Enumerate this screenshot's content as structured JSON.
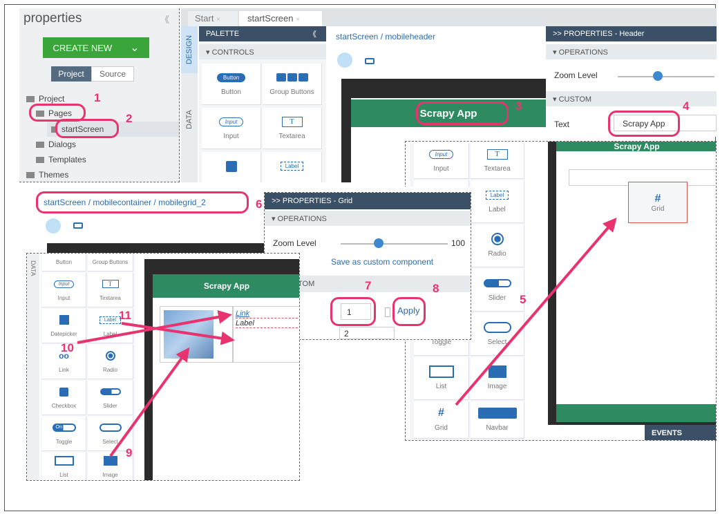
{
  "left_panel": {
    "title": "properties",
    "collapse": "《",
    "create_new": "CREATE NEW",
    "create_chevron": "⌄",
    "tab_project": "Project",
    "tab_source": "Source",
    "tree": [
      "Project",
      "Pages",
      "startScreen",
      "Dialogs",
      "Templates",
      "Themes"
    ]
  },
  "tabs": {
    "start": "Start",
    "start_close": "×",
    "startscreen": "startScreen",
    "startscreen_close": "×"
  },
  "side_tabs": {
    "design": "DESIGN",
    "data": "DATA"
  },
  "palette": {
    "title": "PALETTE",
    "collapse": "《",
    "section": "▾ CONTROLS",
    "items": [
      {
        "label": "Button",
        "icon_text": "Button"
      },
      {
        "label": "Group Buttons"
      },
      {
        "label": "Input",
        "icon_text": "Input"
      },
      {
        "label": "Textarea",
        "icon_text": "T"
      },
      {
        "label": ""
      },
      {
        "label": "",
        "icon_text": "Label"
      }
    ]
  },
  "screen1": {
    "breadcrumb": "startScreen / mobileheader",
    "header": "Scrapy App"
  },
  "props_header": {
    "title": ">> PROPERTIES - Header",
    "operations": "▾ OPERATIONS",
    "zoom": "Zoom Level",
    "custom": "▾ CUSTOM",
    "text_label": "Text",
    "text_value": "Scrapy App"
  },
  "palette_right": {
    "items": [
      {
        "label": "Input",
        "icon_text": "Input"
      },
      {
        "label": "Textarea",
        "icon_text": "T"
      },
      {
        "label": "",
        "icon_text": ""
      },
      {
        "label": "Label",
        "icon_text": "Label"
      },
      {
        "label": "Radio"
      },
      {
        "label": "Slider"
      },
      {
        "label": "Toggle"
      },
      {
        "label": "Select"
      },
      {
        "label": "List"
      },
      {
        "label": "Image"
      },
      {
        "label": "Grid"
      },
      {
        "label": "Navbar"
      }
    ]
  },
  "screen_right": {
    "header": "Scrapy App",
    "grid_label": "Grid",
    "events": "EVENTS"
  },
  "second": {
    "breadcrumb": "startScreen / mobilecontainer / mobilegrid_2",
    "props_title": ">> PROPERTIES - Grid",
    "operations": "▾ OPERATIONS",
    "zoom": "Zoom Level",
    "zoom_value": "100",
    "save_custom": "Save as custom component",
    "custom": "TOM",
    "rows_value": "1",
    "cols_value": "2",
    "apply": "Apply"
  },
  "palette_left": {
    "data_tab": "DATA",
    "items": [
      {
        "label": "Button"
      },
      {
        "label": "Group Buttons"
      },
      {
        "label": "Input",
        "icon_text": "Input"
      },
      {
        "label": "Textarea",
        "icon_text": "T"
      },
      {
        "label": "Datepicker"
      },
      {
        "label": "Label",
        "icon_text": "Label"
      },
      {
        "label": "Link"
      },
      {
        "label": "Radio"
      },
      {
        "label": "Checkbox"
      },
      {
        "label": "Slider"
      },
      {
        "label": "Toggle",
        "icon_text": "On"
      },
      {
        "label": "Select"
      },
      {
        "label": "List"
      },
      {
        "label": "Image"
      }
    ]
  },
  "screen_left": {
    "header": "Scrapy App",
    "link": "Link",
    "label": "Label"
  },
  "callouts": [
    "1",
    "2",
    "3",
    "4",
    "5",
    "6",
    "7",
    "8",
    "9",
    "10",
    "11"
  ],
  "colors": {
    "accent": "#e8336e",
    "green": "#3aa53a",
    "app_green": "#2e8b61",
    "header_dark": "#3b5066",
    "blue": "#2a6db5"
  }
}
